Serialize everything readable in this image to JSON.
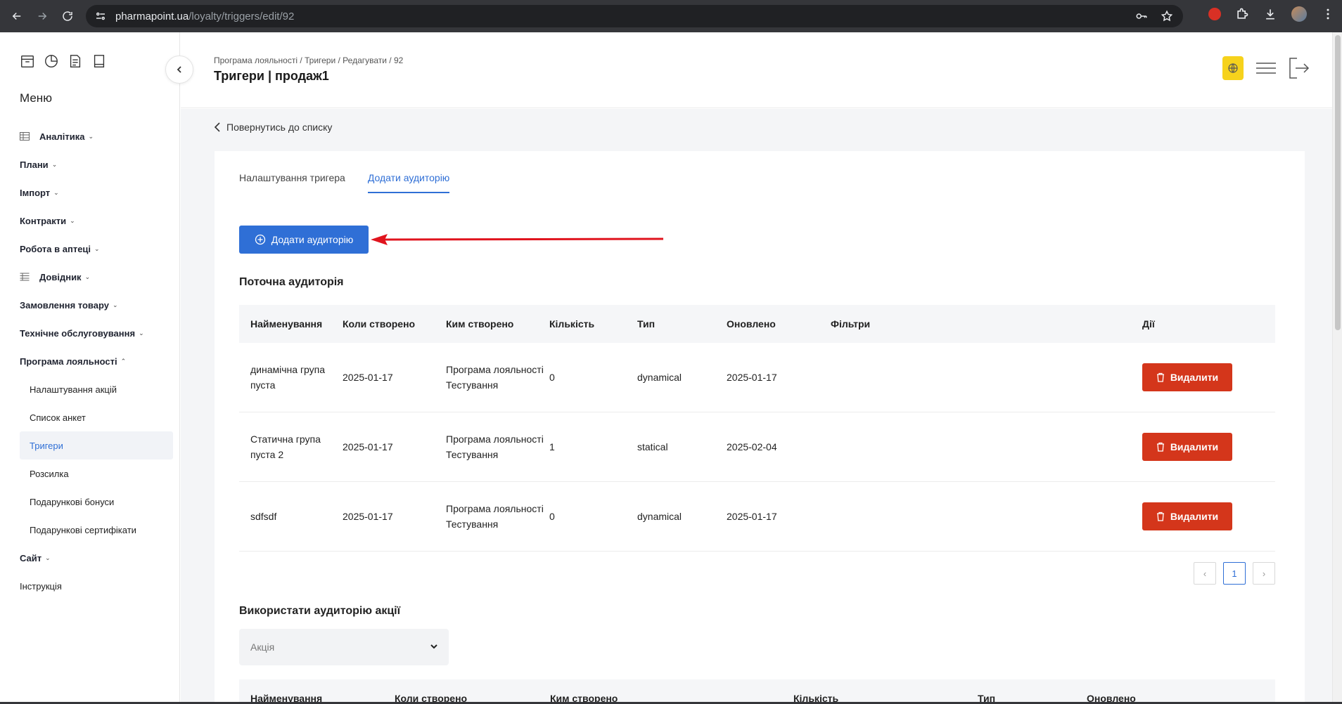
{
  "browser": {
    "url_host": "pharmapoint.ua",
    "url_path": "/loyalty/triggers/edit/92"
  },
  "sidebar": {
    "title": "Меню",
    "items": [
      {
        "label": "Аналітика",
        "icon": "table-icon"
      },
      {
        "label": "Плани"
      },
      {
        "label": "Імпорт"
      },
      {
        "label": "Контракти"
      },
      {
        "label": "Робота в аптеці"
      },
      {
        "label": "Довідник",
        "icon": "list-icon"
      },
      {
        "label": "Замовлення товару"
      },
      {
        "label": "Технічне обслуговування"
      },
      {
        "label": "Програма лояльності"
      }
    ],
    "loyalty_sub": [
      {
        "label": "Налаштування акцій"
      },
      {
        "label": "Список анкет"
      },
      {
        "label": "Тригери",
        "active": true
      },
      {
        "label": "Розсилка"
      },
      {
        "label": "Подарункові бонуси"
      },
      {
        "label": "Подарункові сертифікати"
      }
    ],
    "site": "Сайт",
    "instruction": "Інструкція"
  },
  "header": {
    "breadcrumb": "Програма лояльності / Тригери / Редагувати / 92",
    "title": "Тригери | продаж1",
    "accent": "#f6d21c"
  },
  "main": {
    "back_label": "Повернутись до списку",
    "tabs": [
      {
        "label": "Налаштування тригера",
        "active": false
      },
      {
        "label": "Додати аудиторію",
        "active": true
      }
    ],
    "add_button": "Додати аудиторію",
    "current_title": "Поточна аудиторія",
    "columns": [
      "Найменування",
      "Коли створено",
      "Ким створено",
      "Кількість",
      "Тип",
      "Оновлено",
      "Фільтри",
      "Дії"
    ],
    "rows": [
      {
        "name": "динамічна група пуста",
        "created": "2025-01-17",
        "author": "Програма лояльності Тестування",
        "count": "0",
        "type": "dynamical",
        "updated": "2025-01-17",
        "filters": ""
      },
      {
        "name": "Статична група пуста 2",
        "created": "2025-01-17",
        "author": "Програма лояльності Тестування",
        "count": "1",
        "type": "statical",
        "updated": "2025-02-04",
        "filters": ""
      },
      {
        "name": "sdfsdf",
        "created": "2025-01-17",
        "author": "Програма лояльності Тестування",
        "count": "0",
        "type": "dynamical",
        "updated": "2025-01-17",
        "filters": ""
      }
    ],
    "delete_label": "Видалити",
    "page": "1",
    "use_title": "Використати аудиторію акції",
    "select_placeholder": "Акція",
    "columns2": [
      "Найменування",
      "Коли створено",
      "Ким створено",
      "Кількість",
      "Тип",
      "Оновлено"
    ],
    "colors": {
      "primary": "#2f6fd6",
      "danger": "#d4361b",
      "annotation": "#e0141e"
    }
  }
}
